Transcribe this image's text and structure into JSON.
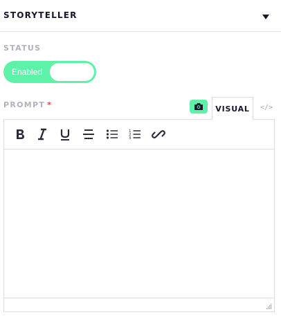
{
  "panel": {
    "title": "STORYTELLER",
    "toggle_icon": "caret-down-icon"
  },
  "status": {
    "label": "STATUS",
    "toggle_text": "Enabled",
    "enabled": true
  },
  "prompt": {
    "label": "PROMPT",
    "required_mark": "*",
    "media_icon": "camera-icon",
    "tabs": [
      {
        "label": "VISUAL",
        "active": true
      },
      {
        "label": "</>",
        "active": false
      }
    ],
    "toolbar": [
      "bold-icon",
      "italic-icon",
      "underline-icon",
      "strikethrough-icon",
      "bullet-list-icon",
      "numbered-list-icon",
      "link-icon"
    ],
    "content": ""
  },
  "colors": {
    "accent": "#5ef2a8",
    "heading": "#15172f",
    "muted_label": "#b2b2bc",
    "required": "#e53e3e",
    "border": "#dcdce2"
  }
}
